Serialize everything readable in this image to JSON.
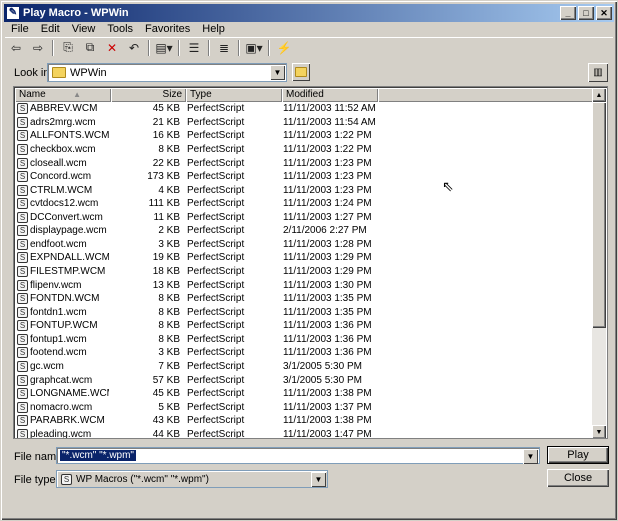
{
  "window": {
    "title": "Play Macro - WPWin",
    "app_icon_glyph": "✎",
    "minimize_glyph": "_",
    "maximize_glyph": "□",
    "close_glyph": "✕"
  },
  "menu": [
    "File",
    "Edit",
    "View",
    "Tools",
    "Favorites",
    "Help"
  ],
  "toolbar": [
    {
      "icon": "back-icon",
      "glyph": "⇦"
    },
    {
      "icon": "forward-icon",
      "glyph": "⇨"
    },
    {
      "icon": "sep"
    },
    {
      "icon": "copy-icon",
      "glyph": "⎘"
    },
    {
      "icon": "paste-icon",
      "glyph": "⧉"
    },
    {
      "icon": "delete-icon",
      "glyph": "✕",
      "color": "#cc0000"
    },
    {
      "icon": "undo-icon",
      "glyph": "↶"
    },
    {
      "icon": "sep"
    },
    {
      "icon": "view-menu-icon",
      "glyph": "▤▾"
    },
    {
      "icon": "sep"
    },
    {
      "icon": "details-view-icon",
      "glyph": "☰"
    },
    {
      "icon": "sep"
    },
    {
      "icon": "list-view-icon",
      "glyph": "≣"
    },
    {
      "icon": "sep"
    },
    {
      "icon": "favorites-menu-icon",
      "glyph": "▣▾"
    },
    {
      "icon": "sep"
    },
    {
      "icon": "network-icon",
      "glyph": "⚡"
    }
  ],
  "lookin": {
    "label": "Look in:",
    "value": "WPWin",
    "arrow": "▼",
    "up_glyph": "↑",
    "properties_glyph": "▥"
  },
  "columns": {
    "name": "Name",
    "sort": "▲",
    "size": "Size",
    "type": "Type",
    "modified": "Modified"
  },
  "file_icon_glyph": "S",
  "files": [
    {
      "name": "ABBREV.WCM",
      "size": "45 KB",
      "type": "PerfectScript",
      "modified": "11/11/2003 11:52 AM"
    },
    {
      "name": "adrs2mrg.wcm",
      "size": "21 KB",
      "type": "PerfectScript",
      "modified": "11/11/2003 11:54 AM"
    },
    {
      "name": "ALLFONTS.WCM",
      "size": "16 KB",
      "type": "PerfectScript",
      "modified": "11/11/2003 1:22 PM"
    },
    {
      "name": "checkbox.wcm",
      "size": "8 KB",
      "type": "PerfectScript",
      "modified": "11/11/2003 1:22 PM"
    },
    {
      "name": "closeall.wcm",
      "size": "22 KB",
      "type": "PerfectScript",
      "modified": "11/11/2003 1:23 PM"
    },
    {
      "name": "Concord.wcm",
      "size": "173 KB",
      "type": "PerfectScript",
      "modified": "11/11/2003 1:23 PM"
    },
    {
      "name": "CTRLM.WCM",
      "size": "4 KB",
      "type": "PerfectScript",
      "modified": "11/11/2003 1:23 PM"
    },
    {
      "name": "cvtdocs12.wcm",
      "size": "111 KB",
      "type": "PerfectScript",
      "modified": "11/11/2003 1:24 PM"
    },
    {
      "name": "DCConvert.wcm",
      "size": "11 KB",
      "type": "PerfectScript",
      "modified": "11/11/2003 1:27 PM"
    },
    {
      "name": "displaypage.wcm",
      "size": "2 KB",
      "type": "PerfectScript",
      "modified": "2/11/2006 2:27 PM"
    },
    {
      "name": "endfoot.wcm",
      "size": "3 KB",
      "type": "PerfectScript",
      "modified": "11/11/2003 1:28 PM"
    },
    {
      "name": "EXPNDALL.WCM",
      "size": "19 KB",
      "type": "PerfectScript",
      "modified": "11/11/2003 1:29 PM"
    },
    {
      "name": "FILESTMP.WCM",
      "size": "18 KB",
      "type": "PerfectScript",
      "modified": "11/11/2003 1:29 PM"
    },
    {
      "name": "flipenv.wcm",
      "size": "13 KB",
      "type": "PerfectScript",
      "modified": "11/11/2003 1:30 PM"
    },
    {
      "name": "FONTDN.WCM",
      "size": "8 KB",
      "type": "PerfectScript",
      "modified": "11/11/2003 1:35 PM"
    },
    {
      "name": "fontdn1.wcm",
      "size": "8 KB",
      "type": "PerfectScript",
      "modified": "11/11/2003 1:35 PM"
    },
    {
      "name": "FONTUP.WCM",
      "size": "8 KB",
      "type": "PerfectScript",
      "modified": "11/11/2003 1:36 PM"
    },
    {
      "name": "fontup1.wcm",
      "size": "8 KB",
      "type": "PerfectScript",
      "modified": "11/11/2003 1:36 PM"
    },
    {
      "name": "footend.wcm",
      "size": "3 KB",
      "type": "PerfectScript",
      "modified": "11/11/2003 1:36 PM"
    },
    {
      "name": "gc.wcm",
      "size": "7 KB",
      "type": "PerfectScript",
      "modified": "3/1/2005 5:30 PM"
    },
    {
      "name": "graphcat.wcm",
      "size": "57 KB",
      "type": "PerfectScript",
      "modified": "3/1/2005 5:30 PM"
    },
    {
      "name": "LONGNAME.WCM",
      "size": "45 KB",
      "type": "PerfectScript",
      "modified": "11/11/2003 1:38 PM"
    },
    {
      "name": "nomacro.wcm",
      "size": "5 KB",
      "type": "PerfectScript",
      "modified": "11/11/2003 1:37 PM"
    },
    {
      "name": "PARABRK.WCM",
      "size": "43 KB",
      "type": "PerfectScript",
      "modified": "11/11/2003 1:38 PM"
    },
    {
      "name": "pleading.wcm",
      "size": "44 KB",
      "type": "PerfectScript",
      "modified": "11/11/2003 1:47 PM"
    }
  ],
  "scroll": {
    "up": "▲",
    "down": "▼"
  },
  "filename": {
    "label": "File name:",
    "value": "\"*.wcm\" \"*.wpm\"",
    "arrow": "▼"
  },
  "filetype": {
    "label": "File type:",
    "value": "WP Macros (\"*.wcm\" \"*.wpm\")",
    "arrow": "▼"
  },
  "buttons": {
    "play": "Play",
    "close": "Close"
  },
  "cursor_glyph": "⇖"
}
